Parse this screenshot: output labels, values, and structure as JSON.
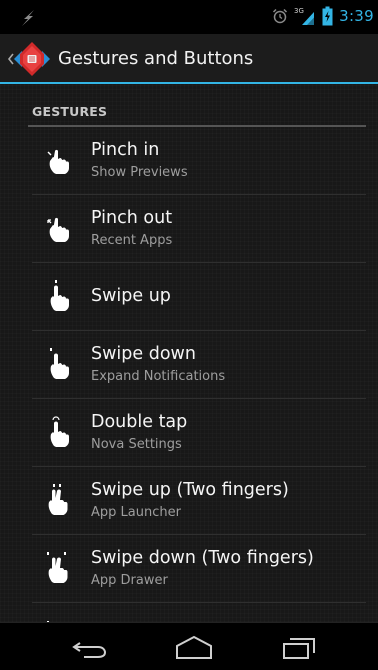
{
  "status_bar": {
    "time": "3:39",
    "network": "3G",
    "icons": [
      "usb-debug-icon",
      "alarm-icon",
      "signal-icon",
      "battery-charging-icon"
    ]
  },
  "action_bar": {
    "title": "Gestures and Buttons",
    "app_icon": "nova-launcher-icon",
    "accent_color": "#33b5e5"
  },
  "section": {
    "header": "GESTURES"
  },
  "items": [
    {
      "title": "Pinch in",
      "summary": "Show Previews",
      "icon": "pinch-in-icon"
    },
    {
      "title": "Pinch out",
      "summary": "Recent Apps",
      "icon": "pinch-out-icon"
    },
    {
      "title": "Swipe up",
      "summary": "",
      "icon": "swipe-up-icon"
    },
    {
      "title": "Swipe down",
      "summary": "Expand Notifications",
      "icon": "swipe-down-icon"
    },
    {
      "title": "Double tap",
      "summary": "Nova Settings",
      "icon": "double-tap-icon"
    },
    {
      "title": "Swipe up (Two fingers)",
      "summary": "App Launcher",
      "icon": "two-finger-swipe-up-icon"
    },
    {
      "title": "Swipe down (Two fingers)",
      "summary": "App Drawer",
      "icon": "two-finger-swipe-down-icon"
    }
  ],
  "nav_bar": {
    "buttons": [
      "back-icon",
      "home-icon",
      "recents-icon"
    ]
  }
}
